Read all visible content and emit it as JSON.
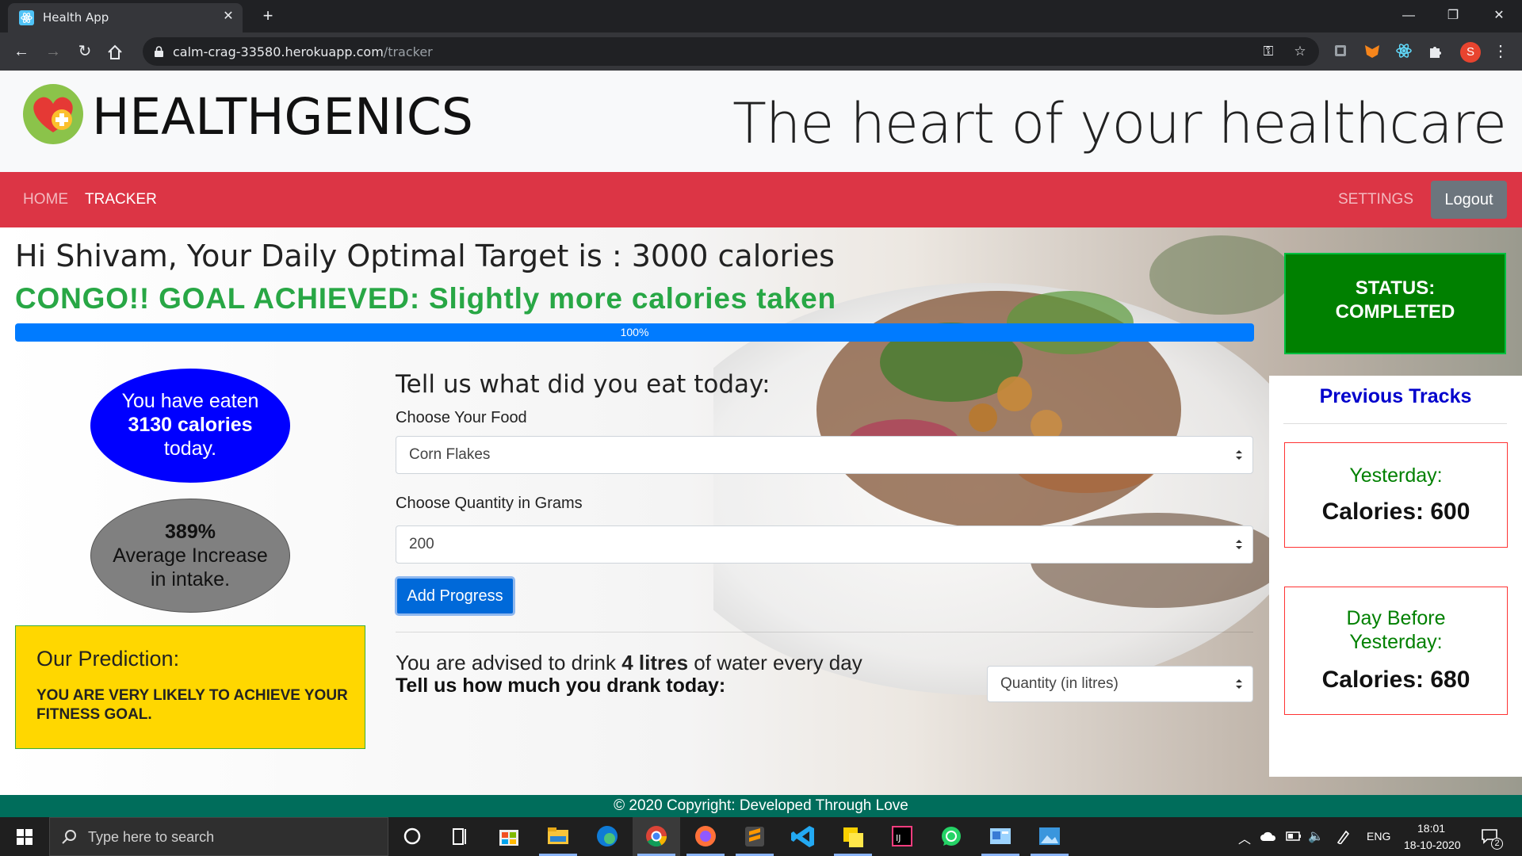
{
  "browser": {
    "tab_title": "Health App",
    "url_host": "calm-crag-33580.herokuapp.com",
    "url_path": "/tracker",
    "profile_initial": "S"
  },
  "header": {
    "brand": "HEALTHGENICS",
    "tagline": "The heart of your healthcare"
  },
  "nav": {
    "home": "HOME",
    "tracker": "TRACKER",
    "settings": "SETTINGS",
    "logout": "Logout"
  },
  "dashboard": {
    "greeting": "Hi Shivam, Your Daily Optimal Target is : 3000 calories",
    "goal_message": "CONGO!! GOAL ACHIEVED: Slightly more calories taken",
    "progress_label": "100%",
    "progress_value": 100,
    "status_line1": "STATUS:",
    "status_line2": "COMPLETED",
    "eaten_line1": "You have eaten",
    "eaten_line2": "3130 calories",
    "eaten_line3": "today.",
    "avg_line1": "389%",
    "avg_line2": "Average Increase",
    "avg_line3": "in intake.",
    "prediction_title": "Our Prediction:",
    "prediction_text": "YOU ARE VERY LIKELY TO ACHIEVE YOUR FITNESS GOAL."
  },
  "form": {
    "title": "Tell us what did you eat today:",
    "food_label": "Choose Your Food",
    "food_value": "Corn Flakes",
    "quantity_label": "Choose Quantity in Grams",
    "quantity_value": "200",
    "add_button": "Add Progress",
    "water_prefix": "You are advised to drink ",
    "water_amount": "4 litres",
    "water_suffix": " of water every day",
    "water_question": "Tell us how much you drank today:",
    "water_select_placeholder": "Quantity (in litres)"
  },
  "tracks": {
    "title": "Previous Tracks",
    "yesterday_label": "Yesterday:",
    "yesterday_calories": "Calories: 600",
    "daybefore_line1": "Day Before",
    "daybefore_line2": "Yesterday:",
    "daybefore_calories": "Calories: 680"
  },
  "footer": {
    "text": "© 2020 Copyright: Developed Through Love"
  },
  "taskbar": {
    "search_placeholder": "Type here to search",
    "language": "ENG",
    "time": "18:01",
    "date": "18-10-2020",
    "notifications": "2"
  },
  "colors": {
    "navbar": "#dc3545",
    "status_green": "#008000",
    "goal_green": "#28a745",
    "progress_blue": "#007bff",
    "prediction_yellow": "#ffd700",
    "footer_teal": "#006d5b"
  }
}
